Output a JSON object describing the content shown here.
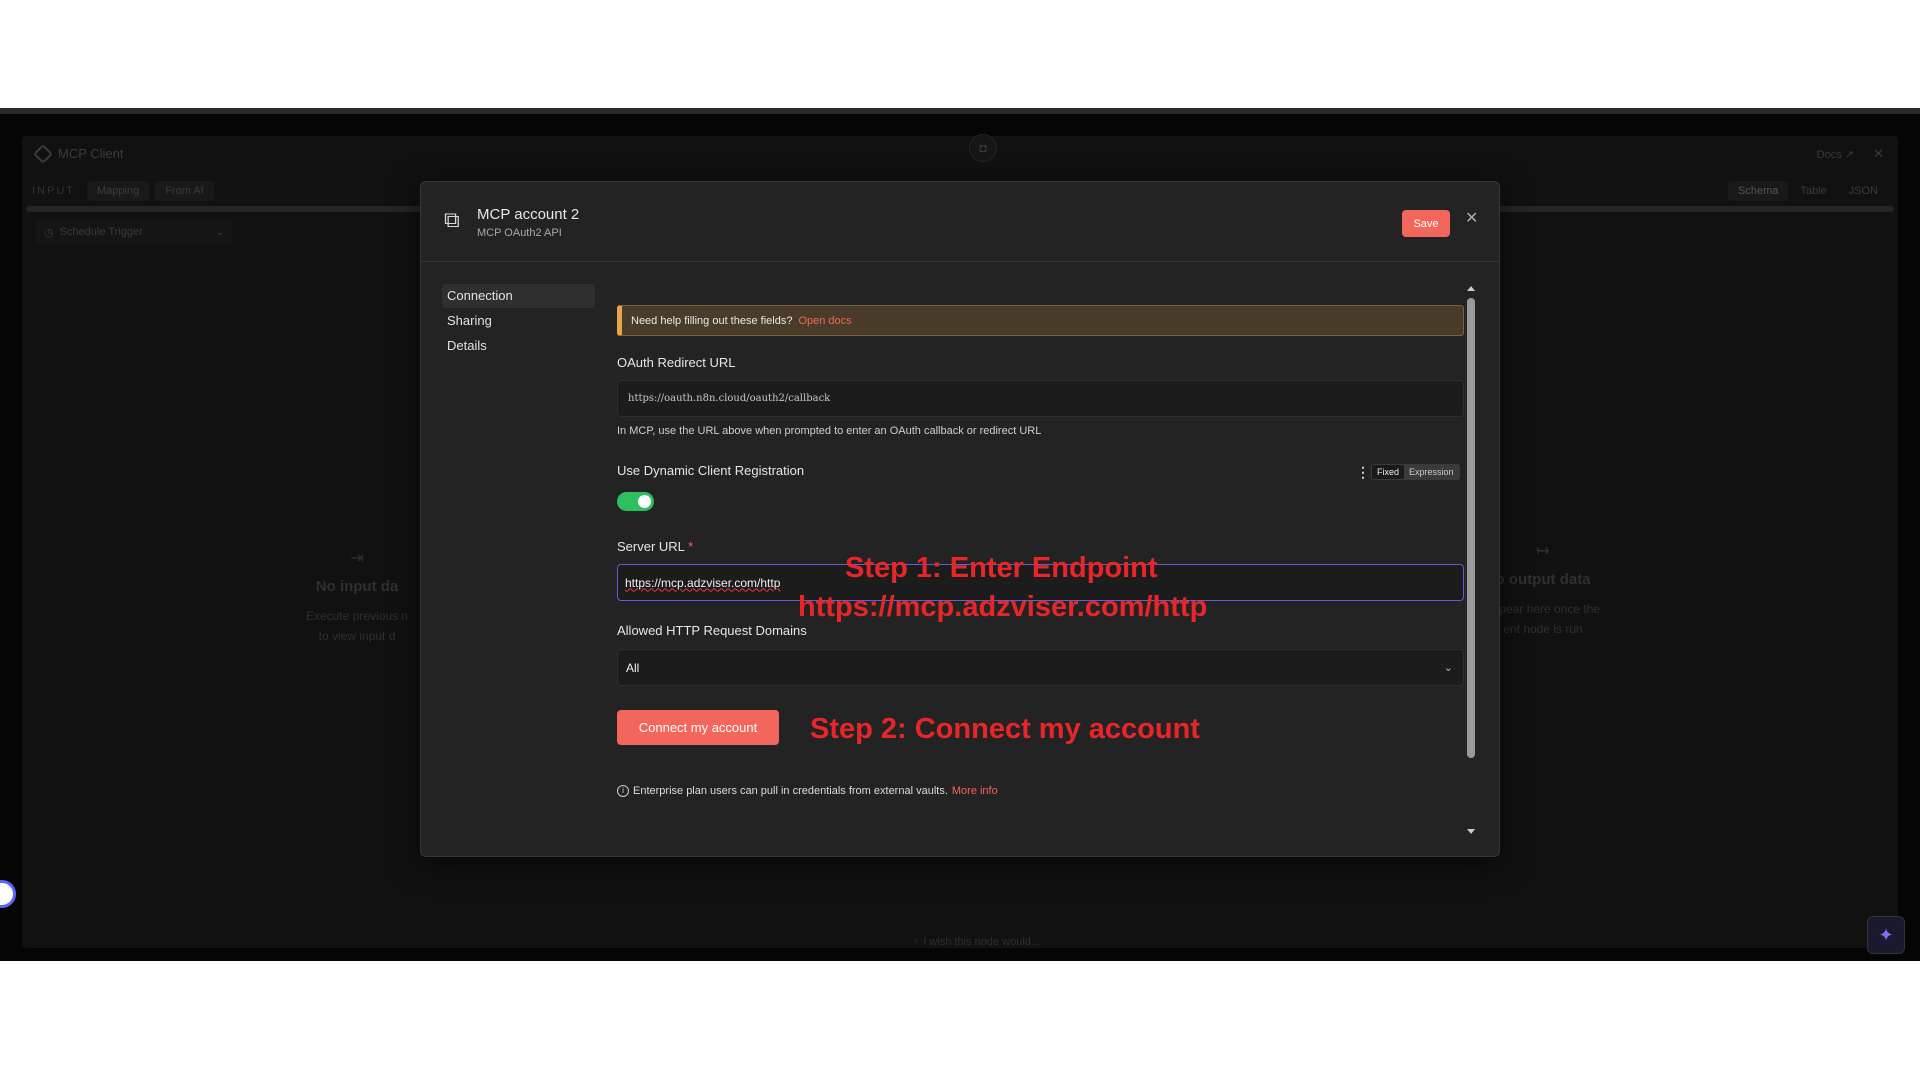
{
  "background_panel": {
    "title": "MCP Client",
    "docs_label": "Docs",
    "input_label": "INPUT",
    "input_tabs": [
      "Mapping",
      "From AI"
    ],
    "view_tabs": [
      "Schema",
      "Table",
      "JSON"
    ],
    "trigger_select": "Schedule Trigger",
    "no_input_title": "No input da",
    "no_input_line1": "Execute previous n",
    "no_input_line2": "to view input d",
    "no_output_title": "o output data",
    "no_output_line1": "appear here once the",
    "no_output_line2": "ent node is run",
    "wish_text": "I wish this node would..."
  },
  "modal": {
    "title": "MCP account 2",
    "subtitle": "MCP OAuth2 API",
    "save_label": "Save",
    "sidebar": [
      "Connection",
      "Sharing",
      "Details"
    ],
    "help_text": "Need help filling out these fields?",
    "help_link": "Open docs",
    "oauth_label": "OAuth Redirect URL",
    "oauth_value": "https://oauth.n8n.cloud/oauth2/callback",
    "oauth_hint": "In MCP, use the URL above when prompted to enter an OAuth callback or redirect URL",
    "dynamic_label": "Use Dynamic Client Registration",
    "fixed_label": "Fixed",
    "expression_label": "Expression",
    "dynamic_enabled": true,
    "server_label": "Server URL",
    "server_required_mark": "*",
    "server_value": "https://mcp.adzviser.com/http",
    "domains_label": "Allowed HTTP Request Domains",
    "domains_value": "All",
    "connect_label": "Connect my account",
    "enterprise_text": "Enterprise plan users can pull in credentials from external vaults.",
    "enterprise_link": "More info"
  },
  "annotations": {
    "step1_line1": "Step 1:  Enter Endpoint",
    "step1_line2": "https://mcp.adzviser.com/http",
    "step2": "Step 2:  Connect my account"
  },
  "colors": {
    "accent": "#f2665b",
    "toggle_on": "#2ec060",
    "annotation": "#e8262a"
  }
}
